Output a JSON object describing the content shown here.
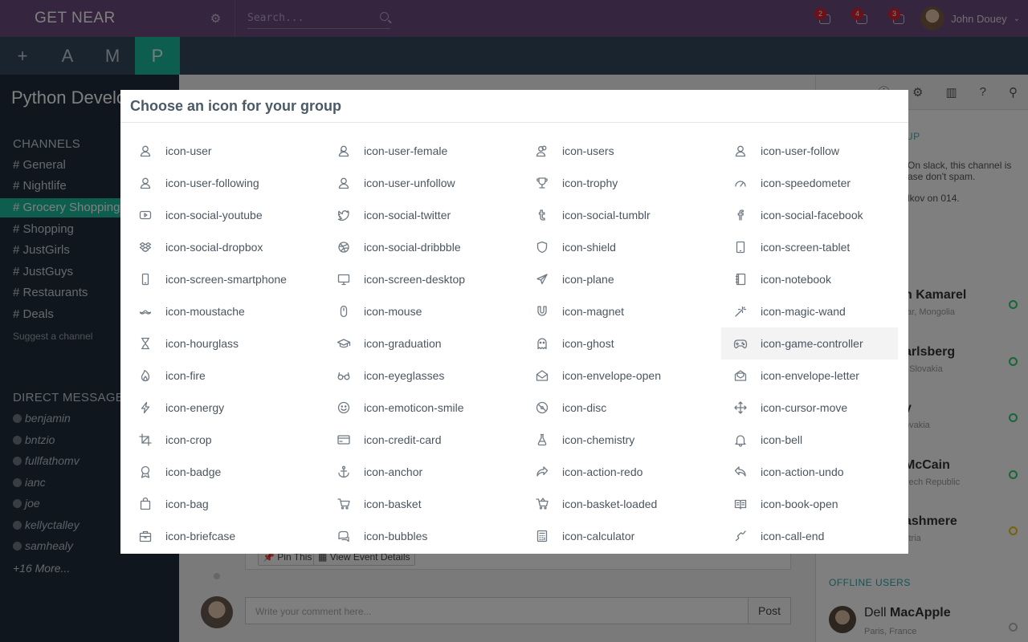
{
  "app": {
    "brand": "GET NEAR",
    "search_placeholder": "Search...",
    "notifications": [
      {
        "count": "2",
        "icon": "user-icon"
      },
      {
        "count": "4",
        "icon": "envelope-icon"
      },
      {
        "count": "3",
        "icon": "bell-icon"
      }
    ],
    "user_name": "John Douey"
  },
  "tabs": [
    {
      "label": "+"
    },
    {
      "label": "A"
    },
    {
      "label": "M"
    },
    {
      "label": "P",
      "active": true
    }
  ],
  "sidebar": {
    "team_title": "Python Develo",
    "channels_heading": "CHANNELS",
    "channels": [
      "# General",
      "# Nightlife",
      "# Grocery Shopping",
      "# Shopping",
      "# JustGirls",
      "# JustGuys",
      "# Restaurants",
      "# Deals"
    ],
    "active_channel_index": 2,
    "suggest": "Suggest a channel",
    "dm_heading": "DIRECT MESSAGES",
    "direct_messages": [
      "benjamin",
      "bntzio",
      "fullfathomv",
      "ianc",
      "joe",
      "kellyctalley",
      "samhealy"
    ],
    "more": "+16 More..."
  },
  "feed": {
    "pin_label": "Pin This",
    "event_label": "View Event Details",
    "comment_placeholder": "Write your comment here...",
    "post_label": "Post"
  },
  "right_panel": {
    "section_heading": "UP",
    "desc1": "On slack, this channel is ase don't spam.",
    "desc2": "lkov on 014.",
    "users": [
      {
        "name": "h Kamarel",
        "location": "tar, Mongolia",
        "status": "online"
      },
      {
        "name": "arlsberg",
        "location": ", Slovakia",
        "status": "online"
      },
      {
        "name": "y",
        "location": "ovakia",
        "status": "online"
      },
      {
        "name": "McCain",
        "location": "zech Republic",
        "status": "online"
      },
      {
        "name": "ashmere",
        "location": "stria",
        "status": "away"
      }
    ],
    "offline_heading": "OFFLINE USERS",
    "offline_user_first": "Dell",
    "offline_user_last": "MacApple",
    "offline_location": "Paris, France"
  },
  "modal": {
    "title": "Choose an icon for your group",
    "highlighted": "icon-game-controller",
    "icons": [
      "icon-user",
      "icon-user-female",
      "icon-users",
      "icon-user-follow",
      "icon-user-following",
      "icon-user-unfollow",
      "icon-trophy",
      "icon-speedometer",
      "icon-social-youtube",
      "icon-social-twitter",
      "icon-social-tumblr",
      "icon-social-facebook",
      "icon-social-dropbox",
      "icon-social-dribbble",
      "icon-shield",
      "icon-screen-tablet",
      "icon-screen-smartphone",
      "icon-screen-desktop",
      "icon-plane",
      "icon-notebook",
      "icon-moustache",
      "icon-mouse",
      "icon-magnet",
      "icon-magic-wand",
      "icon-hourglass",
      "icon-graduation",
      "icon-ghost",
      "icon-game-controller",
      "icon-fire",
      "icon-eyeglasses",
      "icon-envelope-open",
      "icon-envelope-letter",
      "icon-energy",
      "icon-emoticon-smile",
      "icon-disc",
      "icon-cursor-move",
      "icon-crop",
      "icon-credit-card",
      "icon-chemistry",
      "icon-bell",
      "icon-badge",
      "icon-anchor",
      "icon-action-redo",
      "icon-action-undo",
      "icon-bag",
      "icon-basket",
      "icon-basket-loaded",
      "icon-book-open",
      "icon-briefcase",
      "icon-bubbles",
      "icon-calculator",
      "icon-call-end"
    ]
  }
}
